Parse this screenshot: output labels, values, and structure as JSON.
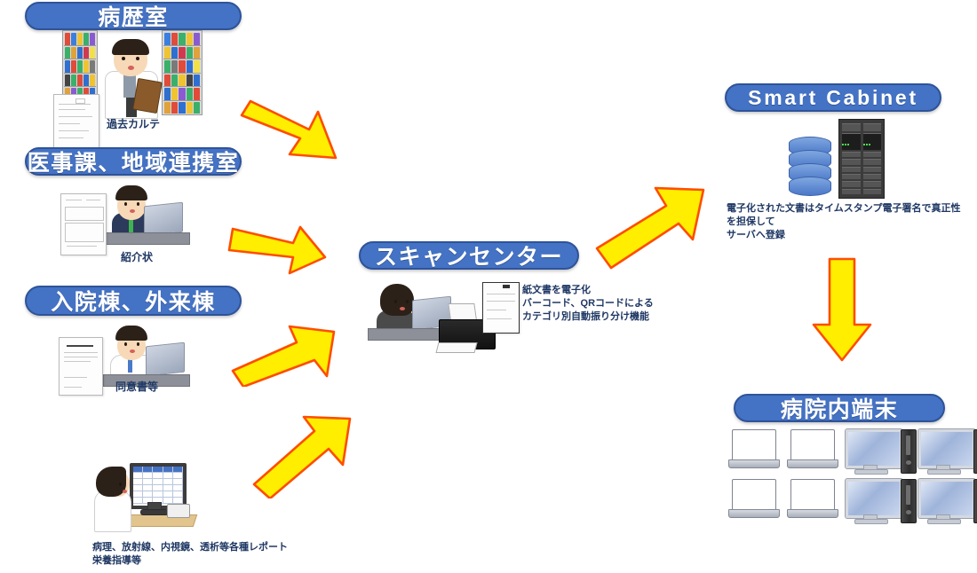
{
  "diagram": {
    "title_groups": {
      "medical_records_room": "病歴室",
      "medical_affairs": "医事課、地域連携室",
      "wards": "入院棟、外来棟",
      "scan_center": "スキャンセンター",
      "smart_cabinet": "Smart Cabinet",
      "hospital_terminals": "病院内端末"
    },
    "captions": {
      "past_charts": "過去カルテ",
      "referral_letter": "紹介状",
      "consent_forms": "同意書等",
      "reports": "病理、放射線、内視鏡、透析等各種レポート\n栄養指導等",
      "scan_center_note": "紙文書を電子化\nバーコード、QRコードによる\nカテゴリ別自動振り分け機能",
      "smart_cabinet_note": "電子化された文書はタイムスタンプ電子署名で真正性を担保して\nサーバへ登録"
    },
    "colors": {
      "pill_fill": "#4472c4",
      "pill_border": "#2e5399",
      "pill_text": "#ffffff",
      "arrow_fill": "#ffee00",
      "arrow_stroke": "#ff4d00",
      "caption_text": "#1f3864",
      "background": "#ffffff"
    },
    "arrows": [
      {
        "name": "arrow-records-to-scan",
        "direction": "down-right"
      },
      {
        "name": "arrow-affairs-to-scan",
        "direction": "right-down"
      },
      {
        "name": "arrow-wards-to-scan",
        "direction": "up-right"
      },
      {
        "name": "arrow-reports-to-scan",
        "direction": "up-right"
      },
      {
        "name": "arrow-scan-to-cabinet",
        "direction": "up-right"
      },
      {
        "name": "arrow-cabinet-to-terminals",
        "direction": "down"
      }
    ]
  }
}
